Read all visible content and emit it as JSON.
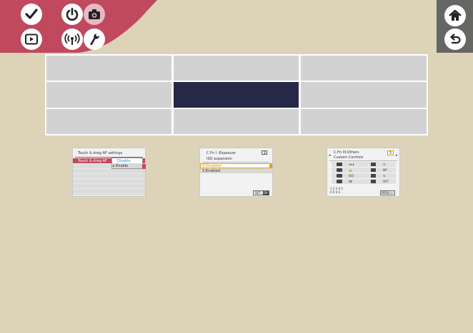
{
  "header": {
    "tabs": [
      {
        "icon": "check-icon"
      },
      {
        "icon": "power-icon"
      },
      {
        "icon": "camera-icon",
        "active": true
      },
      {
        "icon": "playback-icon"
      },
      {
        "icon": "wireless-icon"
      },
      {
        "icon": "wrench-icon"
      }
    ],
    "right_buttons": [
      {
        "icon": "home-icon"
      },
      {
        "icon": "back-icon"
      }
    ],
    "colors": {
      "tab_red": "#c0495e",
      "bar_gray": "#666664",
      "page_bg": "#dcd3b8",
      "highlight": "#262848"
    }
  },
  "grid": {
    "rows": [
      [
        "",
        "",
        ""
      ],
      [
        "",
        "",
        ""
      ],
      [
        "",
        "",
        ""
      ]
    ],
    "highlighted_cell": "row 2, column 2"
  },
  "thumbnails": {
    "touch_drag": {
      "title": "Touch & drag AF settings",
      "row_label": "Touch & drag AF",
      "options": [
        "Disable",
        "Enable"
      ],
      "selected": "Disable"
    },
    "cfn_exposure": {
      "title": "C.Fn I :Exposure",
      "page_number": "1",
      "subtitle": "ISO expansion",
      "options": [
        "0:Disabled",
        "1:Enabled"
      ],
      "selected": "0:Disabled",
      "footer_label": "SET",
      "footer_icon": "OK"
    },
    "cfn_others": {
      "title": "C.Fn III:Others",
      "page_number": "5",
      "subtitle": "Custom Controls",
      "icons_left": [
        "shutter-icon",
        "af-on-icon",
        "ae-lock-icon",
        "set-icon"
      ],
      "values_left": [
        "⋙ℹ",
        "🔒",
        "ISO",
        "🎞"
      ],
      "values_right": [
        "⊡",
        "MF",
        "↯",
        "OFF"
      ],
      "footer_numbers": "1 2 3 4 5",
      "footer_digits": "0 0 0 0 -",
      "footer_label": "MENU"
    }
  }
}
